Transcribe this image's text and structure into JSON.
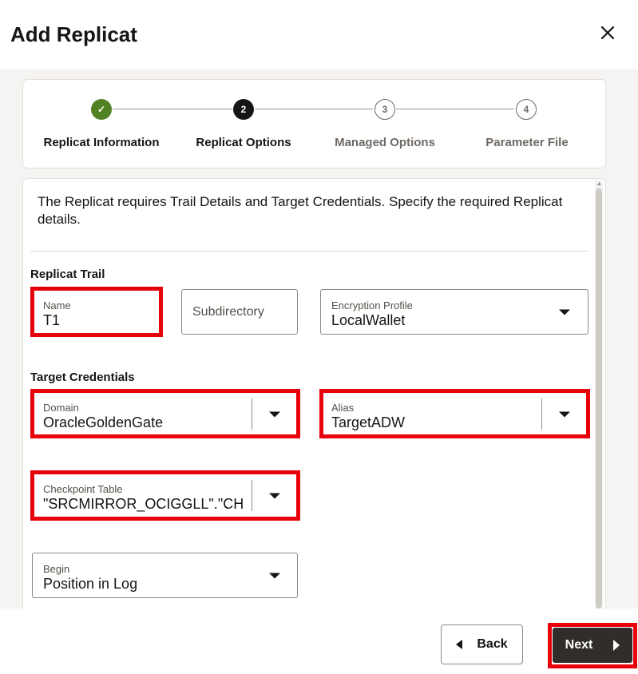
{
  "dialog": {
    "title": "Add Replicat",
    "close_icon": "close-icon"
  },
  "train": {
    "steps": [
      {
        "label": "Replicat Information",
        "marker": "✓",
        "state": "done"
      },
      {
        "label": "Replicat Options",
        "marker": "2",
        "state": "current"
      },
      {
        "label": "Managed Options",
        "marker": "3",
        "state": "todo"
      },
      {
        "label": "Parameter File",
        "marker": "4",
        "state": "todo"
      }
    ]
  },
  "form": {
    "intro": "The Replicat requires Trail Details and Target Credentials. Specify the required Replicat details.",
    "replicat_trail": {
      "section_label": "Replicat Trail",
      "name": {
        "label": "Name",
        "value": "T1"
      },
      "subdirectory": {
        "placeholder": "Subdirectory"
      },
      "encryption_profile": {
        "label": "Encryption Profile",
        "value": "LocalWallet"
      }
    },
    "target_credentials": {
      "section_label": "Target Credentials",
      "domain": {
        "label": "Domain",
        "value": "OracleGoldenGate"
      },
      "alias": {
        "label": "Alias",
        "value": "TargetADW"
      },
      "checkpoint_table": {
        "label": "Checkpoint Table",
        "value": "\"SRCMIRROR_OCIGGLL\".\"CHI"
      },
      "begin": {
        "label": "Begin",
        "value": "Position in Log"
      }
    }
  },
  "footer": {
    "back_label": "Back",
    "next_label": "Next"
  },
  "colors": {
    "highlight": "#e8000b",
    "step_done": "#508223",
    "primary_button": "#312d2a"
  }
}
